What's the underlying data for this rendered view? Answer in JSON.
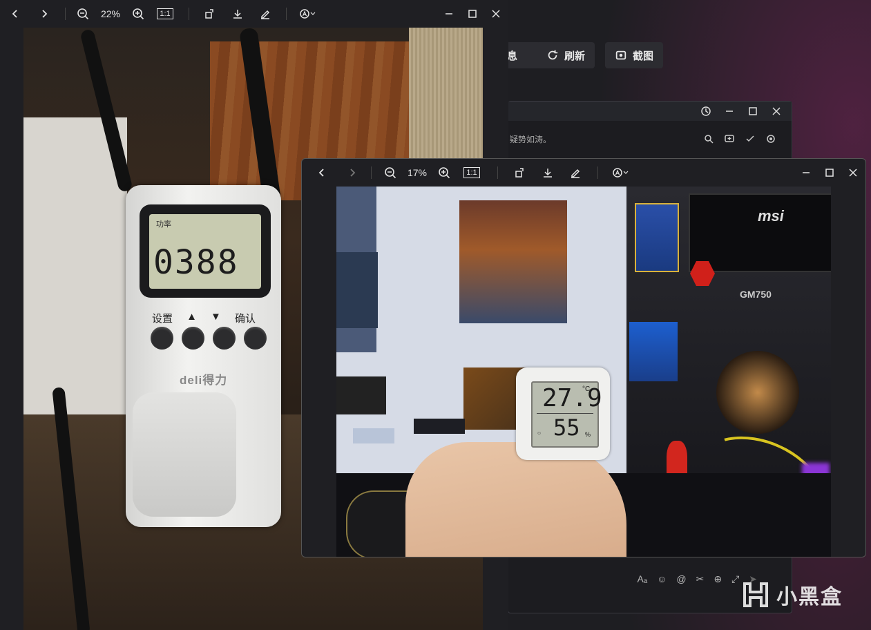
{
  "background_app": {
    "buttons": [
      {
        "label": "息",
        "icon": "info-icon"
      },
      {
        "label": "刷新",
        "icon": "refresh-icon"
      },
      {
        "label": "截图",
        "icon": "screenshot-icon"
      }
    ]
  },
  "chat_window": {
    "subtitle_text": "疑势如涛。"
  },
  "viewer_1": {
    "zoom": "22%",
    "actual_size_label": "1:1",
    "photo": {
      "lcd_label": "功率",
      "lcd_value": "0388",
      "button_labels": [
        "设置",
        "▲",
        "▼",
        "确认"
      ],
      "brand": "deli得力"
    }
  },
  "viewer_2": {
    "zoom": "17%",
    "actual_size_label": "1:1",
    "photo": {
      "temperature": "27.9",
      "temp_unit": "°C",
      "humidity": "55",
      "humidity_unit": "%",
      "rig_brand": "msi",
      "psu_model": "GM750"
    }
  },
  "watermark": {
    "text": "小黑盒"
  },
  "colors": {
    "window_bg": "#1f1f23",
    "desktop_bg": "#1e1e22",
    "accent_pink": "#aa2878"
  }
}
